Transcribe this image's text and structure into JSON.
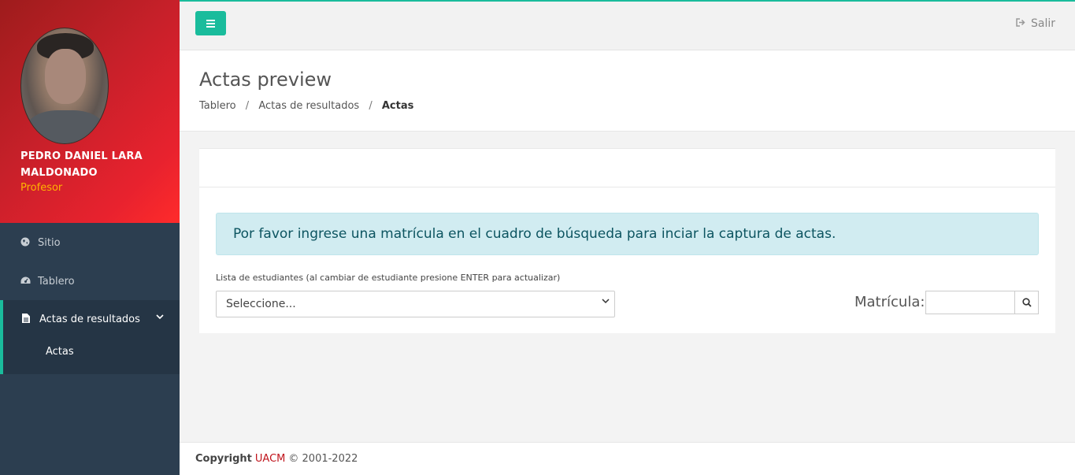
{
  "profile": {
    "name": "PEDRO DANIEL LARA MALDONADO",
    "role": "Profesor"
  },
  "sidebar": {
    "items": [
      {
        "label": "Sitio",
        "icon": "globe-icon"
      },
      {
        "label": "Tablero",
        "icon": "dashboard-icon"
      },
      {
        "label": "Actas de resultados",
        "icon": "file-icon",
        "expanded": true,
        "children": [
          {
            "label": "Actas"
          }
        ]
      }
    ]
  },
  "topbar": {
    "logout_label": "Salir"
  },
  "header": {
    "title": "Actas preview",
    "breadcrumb": [
      "Tablero",
      "Actas de resultados",
      "Actas"
    ]
  },
  "main": {
    "alert_text": "Por favor ingrese una matrícula en el cuadro de búsqueda para inciar la captura de actas.",
    "select_label": "Lista de estudiantes (al cambiar de estudiante presione ENTER para actualizar)",
    "select_value": "Seleccione...",
    "matricula_label": "Matrícula:",
    "matricula_value": ""
  },
  "footer": {
    "copyright_label": "Copyright",
    "brand": "UACM",
    "years": "© 2001-2022"
  },
  "colors": {
    "accent": "#1abc9c",
    "sidebar_bg": "#2c3e50",
    "profile_red": "#e8222e",
    "role_color": "#ffb400",
    "alert_bg": "#d1ecf1",
    "brand_red": "#c0141c"
  }
}
